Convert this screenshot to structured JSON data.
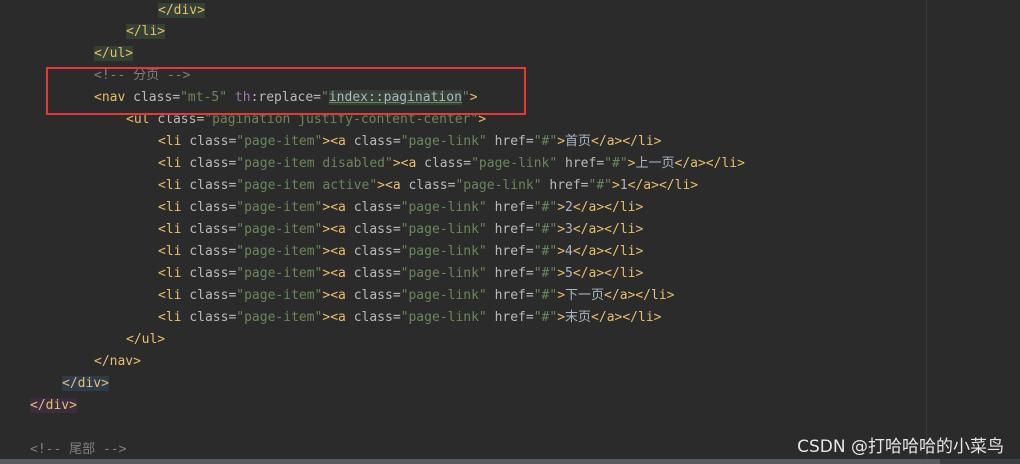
{
  "code_lines": [
    {
      "tokens": [
        {
          "t": "tag",
          "s": "</div>"
        }
      ]
    },
    {
      "tokens": [
        {
          "t": "tag",
          "s": "</li>"
        }
      ]
    },
    {
      "tokens": [
        {
          "t": "tag",
          "s": "</ul>"
        }
      ]
    },
    {
      "tokens": [
        {
          "t": "comment",
          "s": "<!-- 分页 -->"
        }
      ]
    },
    {
      "tokens": [
        {
          "t": "tag",
          "s": "<nav "
        },
        {
          "t": "attr",
          "s": "class="
        },
        {
          "t": "val",
          "s": "\"mt-5\""
        },
        {
          "t": "attr",
          "s": " "
        },
        {
          "t": "ns",
          "s": "th"
        },
        {
          "t": "attr",
          "s": ":replace="
        },
        {
          "t": "val",
          "s": "\""
        },
        {
          "t": "ref",
          "s": "index::pagination"
        },
        {
          "t": "val",
          "s": "\""
        },
        {
          "t": "tag",
          "s": ">"
        }
      ]
    },
    {
      "tokens": [
        {
          "t": "tag",
          "s": "<ul "
        },
        {
          "t": "attr",
          "s": "class="
        },
        {
          "t": "val",
          "s": "\"pagination justify-content-center\""
        },
        {
          "t": "tag",
          "s": ">"
        }
      ]
    },
    {
      "tokens": [
        {
          "t": "tag",
          "s": "<li "
        },
        {
          "t": "attr",
          "s": "class="
        },
        {
          "t": "val",
          "s": "\"page-item\""
        },
        {
          "t": "tag",
          "s": "><a "
        },
        {
          "t": "attr",
          "s": "class="
        },
        {
          "t": "val",
          "s": "\"page-link\""
        },
        {
          "t": "attr",
          "s": " href="
        },
        {
          "t": "val",
          "s": "\"#\""
        },
        {
          "t": "tag",
          "s": ">"
        },
        {
          "t": "text",
          "s": "首页"
        },
        {
          "t": "tag",
          "s": "</a></li>"
        }
      ]
    },
    {
      "tokens": [
        {
          "t": "tag",
          "s": "<li "
        },
        {
          "t": "attr",
          "s": "class="
        },
        {
          "t": "val",
          "s": "\"page-item disabled\""
        },
        {
          "t": "tag",
          "s": "><a "
        },
        {
          "t": "attr",
          "s": "class="
        },
        {
          "t": "val",
          "s": "\"page-link\""
        },
        {
          "t": "attr",
          "s": " href="
        },
        {
          "t": "val",
          "s": "\"#\""
        },
        {
          "t": "tag",
          "s": ">"
        },
        {
          "t": "text",
          "s": "上一页"
        },
        {
          "t": "tag",
          "s": "</a></li>"
        }
      ]
    },
    {
      "tokens": [
        {
          "t": "tag",
          "s": "<li "
        },
        {
          "t": "attr",
          "s": "class="
        },
        {
          "t": "val",
          "s": "\"page-item active\""
        },
        {
          "t": "tag",
          "s": "><a "
        },
        {
          "t": "attr",
          "s": "class="
        },
        {
          "t": "val",
          "s": "\"page-link\""
        },
        {
          "t": "attr",
          "s": " href="
        },
        {
          "t": "val",
          "s": "\"#\""
        },
        {
          "t": "tag",
          "s": ">"
        },
        {
          "t": "text",
          "s": "1"
        },
        {
          "t": "tag",
          "s": "</a></li>"
        }
      ]
    },
    {
      "tokens": [
        {
          "t": "tag",
          "s": "<li "
        },
        {
          "t": "attr",
          "s": "class="
        },
        {
          "t": "val",
          "s": "\"page-item\""
        },
        {
          "t": "tag",
          "s": "><a "
        },
        {
          "t": "attr",
          "s": "class="
        },
        {
          "t": "val",
          "s": "\"page-link\""
        },
        {
          "t": "attr",
          "s": " href="
        },
        {
          "t": "val",
          "s": "\"#\""
        },
        {
          "t": "tag",
          "s": ">"
        },
        {
          "t": "text",
          "s": "2"
        },
        {
          "t": "tag",
          "s": "</a></li>"
        }
      ]
    },
    {
      "tokens": [
        {
          "t": "tag",
          "s": "<li "
        },
        {
          "t": "attr",
          "s": "class="
        },
        {
          "t": "val",
          "s": "\"page-item\""
        },
        {
          "t": "tag",
          "s": "><a "
        },
        {
          "t": "attr",
          "s": "class="
        },
        {
          "t": "val",
          "s": "\"page-link\""
        },
        {
          "t": "attr",
          "s": " href="
        },
        {
          "t": "val",
          "s": "\"#\""
        },
        {
          "t": "tag",
          "s": ">"
        },
        {
          "t": "text",
          "s": "3"
        },
        {
          "t": "tag",
          "s": "</a></li>"
        }
      ]
    },
    {
      "tokens": [
        {
          "t": "tag",
          "s": "<li "
        },
        {
          "t": "attr",
          "s": "class="
        },
        {
          "t": "val",
          "s": "\"page-item\""
        },
        {
          "t": "tag",
          "s": "><a "
        },
        {
          "t": "attr",
          "s": "class="
        },
        {
          "t": "val",
          "s": "\"page-link\""
        },
        {
          "t": "attr",
          "s": " href="
        },
        {
          "t": "val",
          "s": "\"#\""
        },
        {
          "t": "tag",
          "s": ">"
        },
        {
          "t": "text",
          "s": "4"
        },
        {
          "t": "tag",
          "s": "</a></li>"
        }
      ]
    },
    {
      "tokens": [
        {
          "t": "tag",
          "s": "<li "
        },
        {
          "t": "attr",
          "s": "class="
        },
        {
          "t": "val",
          "s": "\"page-item\""
        },
        {
          "t": "tag",
          "s": "><a "
        },
        {
          "t": "attr",
          "s": "class="
        },
        {
          "t": "val",
          "s": "\"page-link\""
        },
        {
          "t": "attr",
          "s": " href="
        },
        {
          "t": "val",
          "s": "\"#\""
        },
        {
          "t": "tag",
          "s": ">"
        },
        {
          "t": "text",
          "s": "5"
        },
        {
          "t": "tag",
          "s": "</a></li>"
        }
      ]
    },
    {
      "tokens": [
        {
          "t": "tag",
          "s": "<li "
        },
        {
          "t": "attr",
          "s": "class="
        },
        {
          "t": "val",
          "s": "\"page-item\""
        },
        {
          "t": "tag",
          "s": "><a "
        },
        {
          "t": "attr",
          "s": "class="
        },
        {
          "t": "val",
          "s": "\"page-link\""
        },
        {
          "t": "attr",
          "s": " href="
        },
        {
          "t": "val",
          "s": "\"#\""
        },
        {
          "t": "tag",
          "s": ">"
        },
        {
          "t": "text",
          "s": "下一页"
        },
        {
          "t": "tag",
          "s": "</a></li>"
        }
      ]
    },
    {
      "tokens": [
        {
          "t": "tag",
          "s": "<li "
        },
        {
          "t": "attr",
          "s": "class="
        },
        {
          "t": "val",
          "s": "\"page-item\""
        },
        {
          "t": "tag",
          "s": "><a "
        },
        {
          "t": "attr",
          "s": "class="
        },
        {
          "t": "val",
          "s": "\"page-link\""
        },
        {
          "t": "attr",
          "s": " href="
        },
        {
          "t": "val",
          "s": "\"#\""
        },
        {
          "t": "tag",
          "s": ">"
        },
        {
          "t": "text",
          "s": "末页"
        },
        {
          "t": "tag",
          "s": "</a></li>"
        }
      ]
    },
    {
      "tokens": [
        {
          "t": "tag",
          "s": "</ul>"
        }
      ]
    },
    {
      "tokens": [
        {
          "t": "tag",
          "s": "</nav>"
        }
      ]
    },
    {
      "tokens": [
        {
          "t": "tag",
          "s": "</div>"
        }
      ]
    },
    {
      "tokens": [
        {
          "t": "tag",
          "s": "</div>"
        }
      ]
    },
    {
      "tokens": []
    },
    {
      "tokens": [
        {
          "t": "comment",
          "s": "<!-- 尾部 -->"
        }
      ]
    }
  ],
  "watermark": "CSDN @打哈哈哈的小菜鸟",
  "colors": {
    "background": "#2b2b2b",
    "tag": "#e8bf6a",
    "attribute": "#bababa",
    "string": "#6a8759",
    "comment": "#808080",
    "namespace": "#9876aa",
    "annotation_box": "#e53935"
  }
}
